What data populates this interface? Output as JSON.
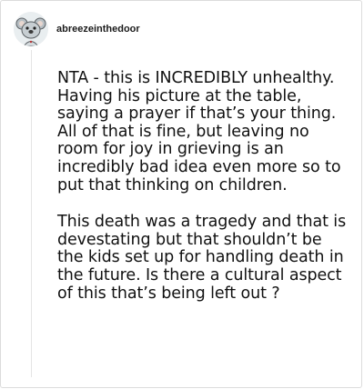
{
  "comment": {
    "username": "abreezeinthedoor",
    "avatar_icon": "koala-avatar-icon",
    "paragraphs": [
      "NTA - this is INCREDIBLY unhealthy. Having his picture at the table, saying a prayer if that’s your thing. All of that is fine, but leaving no room for joy in grieving is an incredibly bad idea even more so to put that thinking on children.",
      "This death was a tragedy and that is devestating but that shouldn’t be the kids set up for handling death in the future. Is there a cultural aspect of this that’s being left out ?"
    ]
  },
  "colors": {
    "border": "#dcdcdc",
    "text": "#111111",
    "thread_line": "#e4e4e4"
  }
}
